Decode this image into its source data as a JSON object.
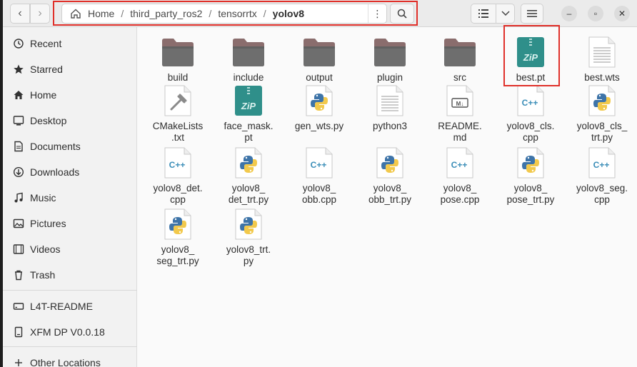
{
  "nav": {
    "back_icon": "chevron-left-icon",
    "forward_icon": "chevron-right-icon"
  },
  "breadcrumb": {
    "items": [
      "Home",
      "third_party_ros2",
      "tensorrtx",
      "yolov8"
    ]
  },
  "toolbar": {
    "path_menu_icon": "vertical-dots-icon",
    "search_icon": "search-icon",
    "view_icon": "list-view-icon",
    "view_dropdown_icon": "chevron-down-icon",
    "main_menu_icon": "hamburger-icon"
  },
  "window": {
    "minimize_icon": "minimize-icon",
    "maximize_icon": "maximize-icon",
    "close_icon": "close-icon"
  },
  "sidebar": {
    "items": [
      {
        "label": "Recent",
        "icon": "clock-icon"
      },
      {
        "label": "Starred",
        "icon": "star-icon"
      },
      {
        "label": "Home",
        "icon": "home-icon"
      },
      {
        "label": "Desktop",
        "icon": "desktop-icon"
      },
      {
        "label": "Documents",
        "icon": "document-icon"
      },
      {
        "label": "Downloads",
        "icon": "download-icon"
      },
      {
        "label": "Music",
        "icon": "music-icon"
      },
      {
        "label": "Pictures",
        "icon": "picture-icon"
      },
      {
        "label": "Videos",
        "icon": "video-icon"
      },
      {
        "label": "Trash",
        "icon": "trash-icon"
      }
    ],
    "devices": [
      {
        "label": "L4T-README",
        "icon": "drive-icon"
      },
      {
        "label": "XFM DP V0.0.18",
        "icon": "drive-icon"
      }
    ],
    "other": {
      "label": "Other Locations",
      "icon": "plus-icon"
    }
  },
  "files": [
    {
      "name": "build",
      "type": "folder"
    },
    {
      "name": "include",
      "type": "folder"
    },
    {
      "name": "output",
      "type": "folder"
    },
    {
      "name": "plugin",
      "type": "folder"
    },
    {
      "name": "src",
      "type": "folder"
    },
    {
      "name": "best.pt",
      "type": "zip"
    },
    {
      "name": "best.wts",
      "type": "text"
    },
    {
      "name": "CMakeLists\n.txt",
      "type": "cmake"
    },
    {
      "name": "face_mask.\npt",
      "type": "zip"
    },
    {
      "name": "gen_wts.py",
      "type": "python"
    },
    {
      "name": "python3",
      "type": "text"
    },
    {
      "name": "README.\nmd",
      "type": "markdown"
    },
    {
      "name": "yolov8_cls.\ncpp",
      "type": "cpp"
    },
    {
      "name": "yolov8_cls_\ntrt.py",
      "type": "python"
    },
    {
      "name": "yolov8_det.\ncpp",
      "type": "cpp"
    },
    {
      "name": "yolov8_\ndet_trt.py",
      "type": "python"
    },
    {
      "name": "yolov8_\nobb.cpp",
      "type": "cpp"
    },
    {
      "name": "yolov8_\nobb_trt.py",
      "type": "python"
    },
    {
      "name": "yolov8_\npose.cpp",
      "type": "cpp"
    },
    {
      "name": "yolov8_\npose_trt.py",
      "type": "python"
    },
    {
      "name": "yolov8_seg.\ncpp",
      "type": "cpp"
    },
    {
      "name": "yolov8_\nseg_trt.py",
      "type": "python"
    },
    {
      "name": "yolov8_trt.\npy",
      "type": "python"
    }
  ],
  "colors": {
    "highlight": "#e0302a",
    "folder": "#8a6d6d",
    "zip": "#2f8f8a",
    "python_blue": "#3e74a8",
    "python_yellow": "#f2c94c"
  }
}
